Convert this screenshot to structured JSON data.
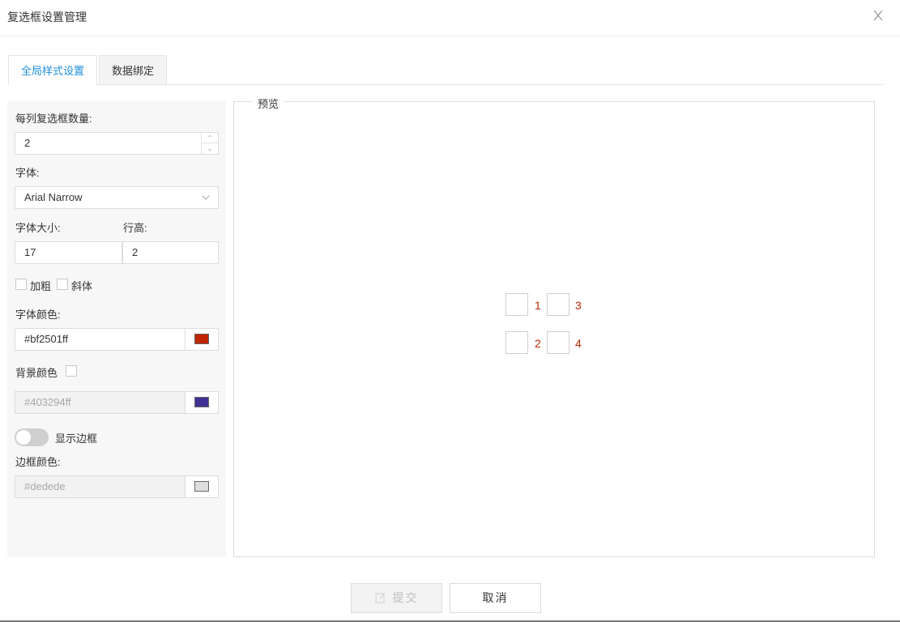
{
  "dialog": {
    "title": "复选框设置管理"
  },
  "tabs": [
    {
      "label": "全局样式设置"
    },
    {
      "label": "数据绑定"
    }
  ],
  "form": {
    "per_column_label": "每列复选框数量:",
    "per_column_value": "2",
    "font_label": "字体:",
    "font_value": "Arial Narrow",
    "font_size_label": "字体大小:",
    "font_size_value": "17",
    "line_height_label": "行高:",
    "line_height_value": "2",
    "bold_label": "加粗",
    "italic_label": "斜体",
    "font_color_label": "字体颜色:",
    "font_color_value": "#bf2501ff",
    "font_color_swatch": "#bf2501",
    "bg_color_label": "背景颜色",
    "bg_color_value": "#403294ff",
    "bg_color_swatch": "#403294",
    "show_border_label": "显示边框",
    "border_color_label": "边框颜色:",
    "border_color_value": "#dedede",
    "border_color_swatch": "#dedede"
  },
  "preview": {
    "legend": "预览",
    "items": [
      "1",
      "3",
      "2",
      "4"
    ]
  },
  "footer": {
    "submit_label": "提交",
    "cancel_label": "取消"
  }
}
